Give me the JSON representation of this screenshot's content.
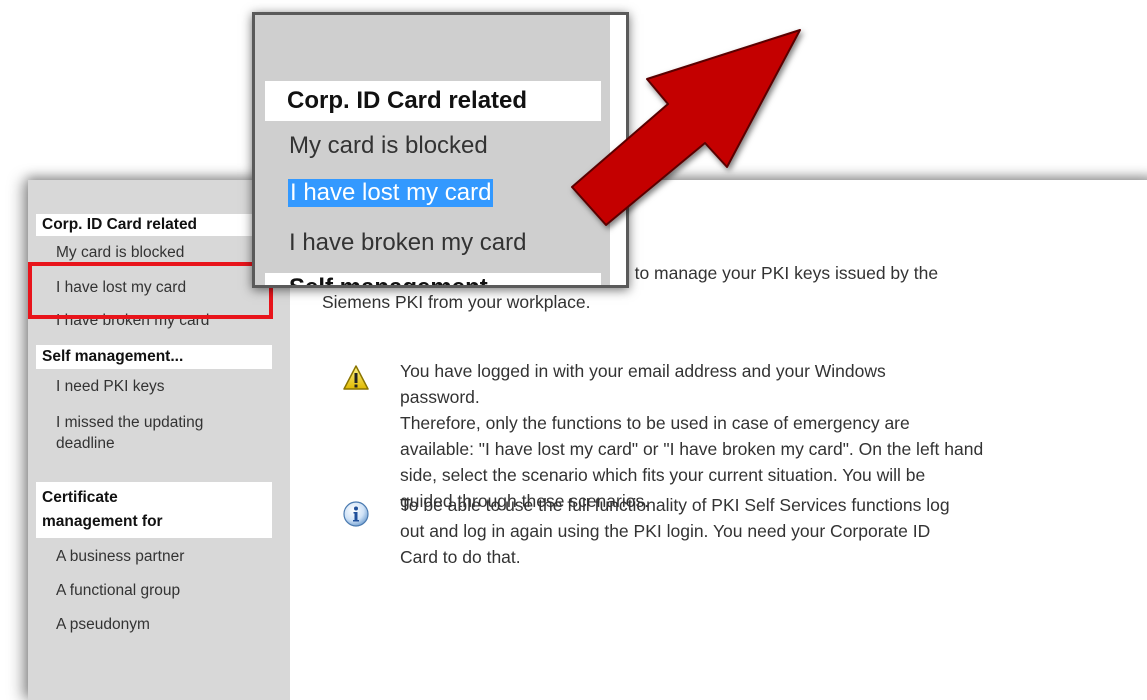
{
  "sidebar": {
    "sections": [
      {
        "heading": "Corp. ID Card related",
        "items": [
          "My card is blocked",
          "I have lost my card",
          "I have broken my card"
        ]
      },
      {
        "heading": "Self management...",
        "items": [
          "I need PKI keys",
          "I missed the updating deadline"
        ]
      },
      {
        "heading_line1": "Certificate",
        "heading_line2": "management for",
        "items": [
          "A business partner",
          "A functional group",
          "A pseudonym"
        ]
      }
    ]
  },
  "zoom": {
    "heading": "Corp. ID Card related",
    "items": [
      "My card is blocked",
      "I have lost my card",
      "I have broken my card"
    ],
    "next_heading_partial": "Self management..."
  },
  "content": {
    "intro_line1": "u to manage your PKI keys issued by the",
    "intro_line2": "Siemens PKI from your workplace.",
    "warning": {
      "line1": "You have logged in with your email address and your Windows",
      "line2": "password.",
      "line3": "Therefore, only the functions to be used in case of emergency are",
      "line4": "available: \"I have lost my card\" or \"I have broken my card\". On the left hand",
      "line5": "side, select the scenario which fits your current situation. You will be",
      "line6": "guided through these scenarios."
    },
    "info": {
      "line1": "To be able to use the full functionality of PKI Self Services functions log",
      "line2": "out and log in again using the PKI login. You need your Corporate ID",
      "line3": "Card to do that."
    }
  },
  "colors": {
    "arrow": "#c40000",
    "highlight_box": "#e8141b",
    "selection": "#3399ff",
    "sidebar_bg": "#d8d8d8"
  }
}
